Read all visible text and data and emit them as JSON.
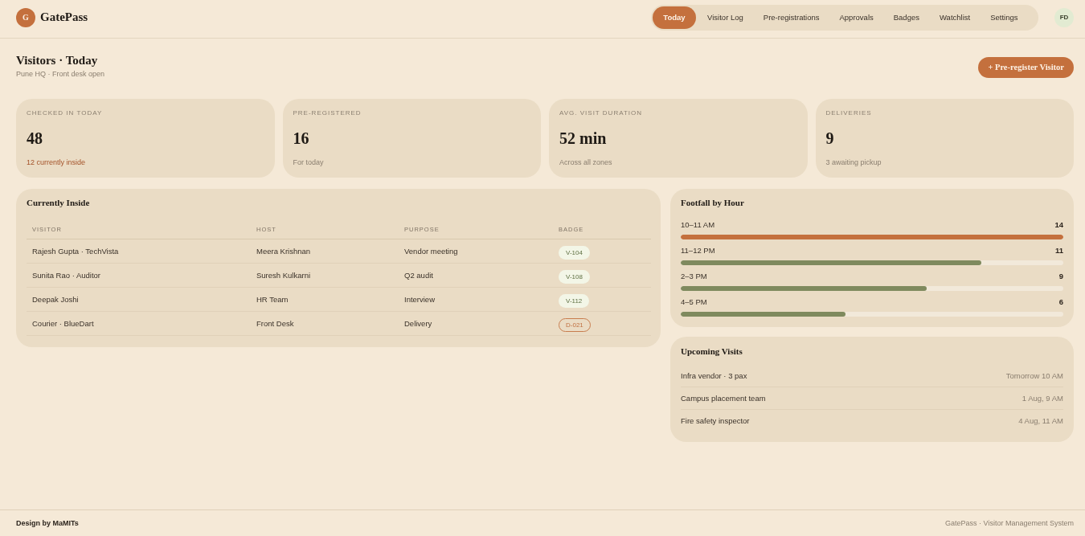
{
  "brand": {
    "logo_letter": "G",
    "name": "GatePass"
  },
  "nav": {
    "tabs": [
      {
        "label": "Today",
        "selected": true
      },
      {
        "label": "Visitor Log",
        "selected": false
      },
      {
        "label": "Pre-registrations",
        "selected": false
      },
      {
        "label": "Approvals",
        "selected": false
      },
      {
        "label": "Badges",
        "selected": false
      },
      {
        "label": "Watchlist",
        "selected": false
      },
      {
        "label": "Settings",
        "selected": false
      }
    ]
  },
  "user": {
    "initials": "FD"
  },
  "page": {
    "title": "Visitors · Today",
    "subtitle": "Pune HQ · Front desk open",
    "action": "+ Pre-register Visitor"
  },
  "stats": [
    {
      "label": "CHECKED IN TODAY",
      "value": "48",
      "note": "12 currently inside",
      "highlighted": true
    },
    {
      "label": "PRE-REGISTERED",
      "value": "16",
      "note": "For today",
      "highlighted": false
    },
    {
      "label": "AVG. VISIT DURATION",
      "value": "52 min",
      "note": "Across all zones",
      "highlighted": false
    },
    {
      "label": "DELIVERIES",
      "value": "9",
      "note": "3 awaiting pickup",
      "highlighted": false
    }
  ],
  "currently_inside": {
    "title": "Currently Inside",
    "columns": [
      "VISITOR",
      "HOST",
      "PURPOSE",
      "BADGE"
    ],
    "rows": [
      {
        "visitor": "Rajesh Gupta · TechVista",
        "host": "Meera Krishnan",
        "purpose": "Vendor meeting",
        "badge": {
          "text": "V-104",
          "kind": "visitor"
        }
      },
      {
        "visitor": "Sunita Rao · Auditor",
        "host": "Suresh Kulkarni",
        "purpose": "Q2 audit",
        "badge": {
          "text": "V-108",
          "kind": "visitor"
        }
      },
      {
        "visitor": "Deepak Joshi",
        "host": "HR Team",
        "purpose": "Interview",
        "badge": {
          "text": "V-112",
          "kind": "visitor"
        }
      },
      {
        "visitor": "Courier · BlueDart",
        "host": "Front Desk",
        "purpose": "Delivery",
        "badge": {
          "text": "D-021",
          "kind": "delivery"
        }
      }
    ]
  },
  "footfall": {
    "title": "Footfall by Hour",
    "rows": [
      {
        "label": "10–11 AM",
        "count": "14",
        "level": 1,
        "color": "#c4703d"
      },
      {
        "label": "11–12 PM",
        "count": "11",
        "level": 0.786,
        "color": "#7f8a5e"
      },
      {
        "label": "2–3 PM",
        "count": "9",
        "level": 0.643,
        "color": "#7f8a5e"
      },
      {
        "label": "4–5 PM",
        "count": "6",
        "level": 0.43,
        "color": "#7f8a5e"
      }
    ]
  },
  "upcoming": {
    "title": "Upcoming Visits",
    "items": [
      {
        "name": "Infra vendor · 3 pax",
        "time": "Tomorrow 10 AM"
      },
      {
        "name": "Campus placement team",
        "time": "1 Aug, 9 AM"
      },
      {
        "name": "Fire safety inspector",
        "time": "4 Aug, 11 AM"
      }
    ]
  },
  "footer": {
    "credit": "Design by MaMITs",
    "product": "GatePass · Visitor Management System"
  }
}
